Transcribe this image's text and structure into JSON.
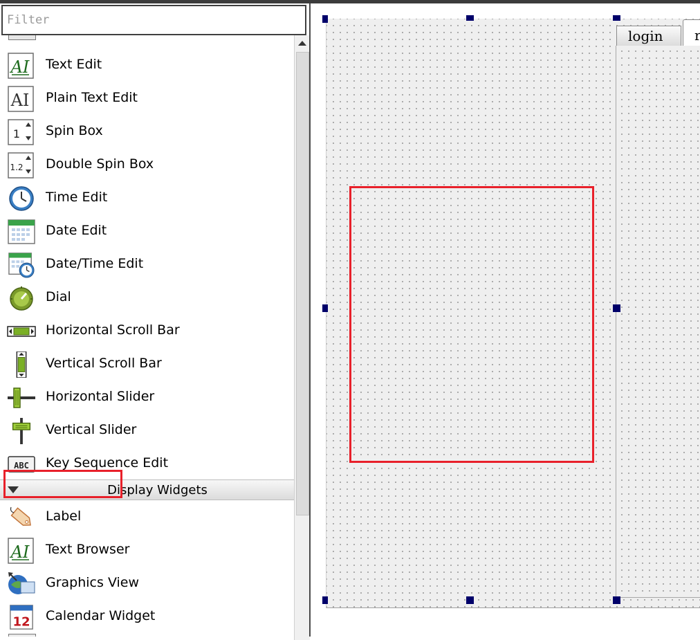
{
  "filter": {
    "placeholder": "Filter",
    "value": ""
  },
  "widgets_top": [
    {
      "label": "Text Edit",
      "icon": "text-edit-icon"
    },
    {
      "label": "Plain Text Edit",
      "icon": "plain-text-edit-icon"
    },
    {
      "label": "Spin Box",
      "icon": "spin-box-icon"
    },
    {
      "label": "Double Spin Box",
      "icon": "double-spin-box-icon"
    },
    {
      "label": "Time Edit",
      "icon": "clock-icon"
    },
    {
      "label": "Date Edit",
      "icon": "calendar-icon"
    },
    {
      "label": "Date/Time Edit",
      "icon": "calendar-clock-icon"
    },
    {
      "label": "Dial",
      "icon": "dial-icon"
    },
    {
      "label": "Horizontal Scroll Bar",
      "icon": "horizontal-scrollbar-icon"
    },
    {
      "label": "Vertical Scroll Bar",
      "icon": "vertical-scrollbar-icon"
    },
    {
      "label": "Horizontal Slider",
      "icon": "horizontal-slider-icon"
    },
    {
      "label": "Vertical Slider",
      "icon": "vertical-slider-icon"
    },
    {
      "label": "Key Sequence Edit",
      "icon": "key-sequence-icon"
    }
  ],
  "category": {
    "label": "Display Widgets",
    "expanded": true
  },
  "widgets_display": [
    {
      "label": "Label",
      "icon": "label-tag-icon",
      "highlighted": true
    },
    {
      "label": "Text Browser",
      "icon": "text-browser-icon"
    },
    {
      "label": "Graphics View",
      "icon": "graphics-view-icon"
    },
    {
      "label": "Calendar Widget",
      "icon": "calendar-widget-icon"
    }
  ],
  "tabs": {
    "first_label": "login",
    "second_label": "r"
  },
  "icon_text": {
    "ai": "AI",
    "spin_1": "1",
    "spin_12": "1.2",
    "abc": "ABC",
    "cal_day": "12"
  },
  "colors": {
    "highlight": "#e8202a",
    "handle": "#00006a",
    "form_bg": "#efefef",
    "grid_dot": "#9a9a9a"
  }
}
